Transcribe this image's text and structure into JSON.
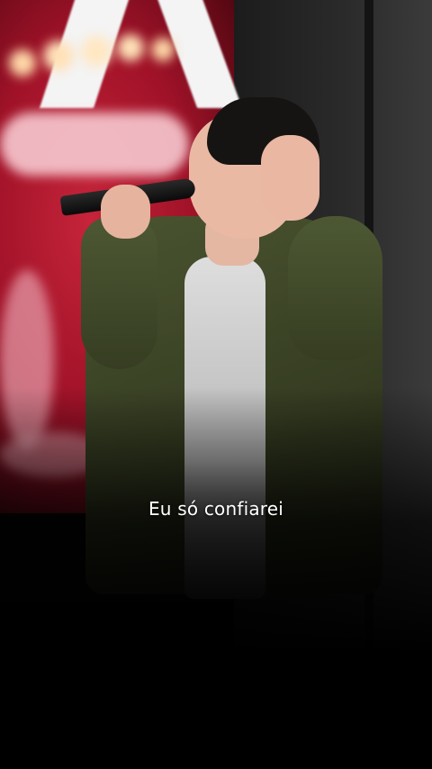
{
  "video": {
    "subtitle": "Eu só confiarei",
    "scene": "photo-singer-on-stage",
    "colors": {
      "stage_red": "#c6243a",
      "jacket_olive": "#4a5430",
      "subtitle_text": "#ffffff",
      "background": "#000000"
    }
  }
}
